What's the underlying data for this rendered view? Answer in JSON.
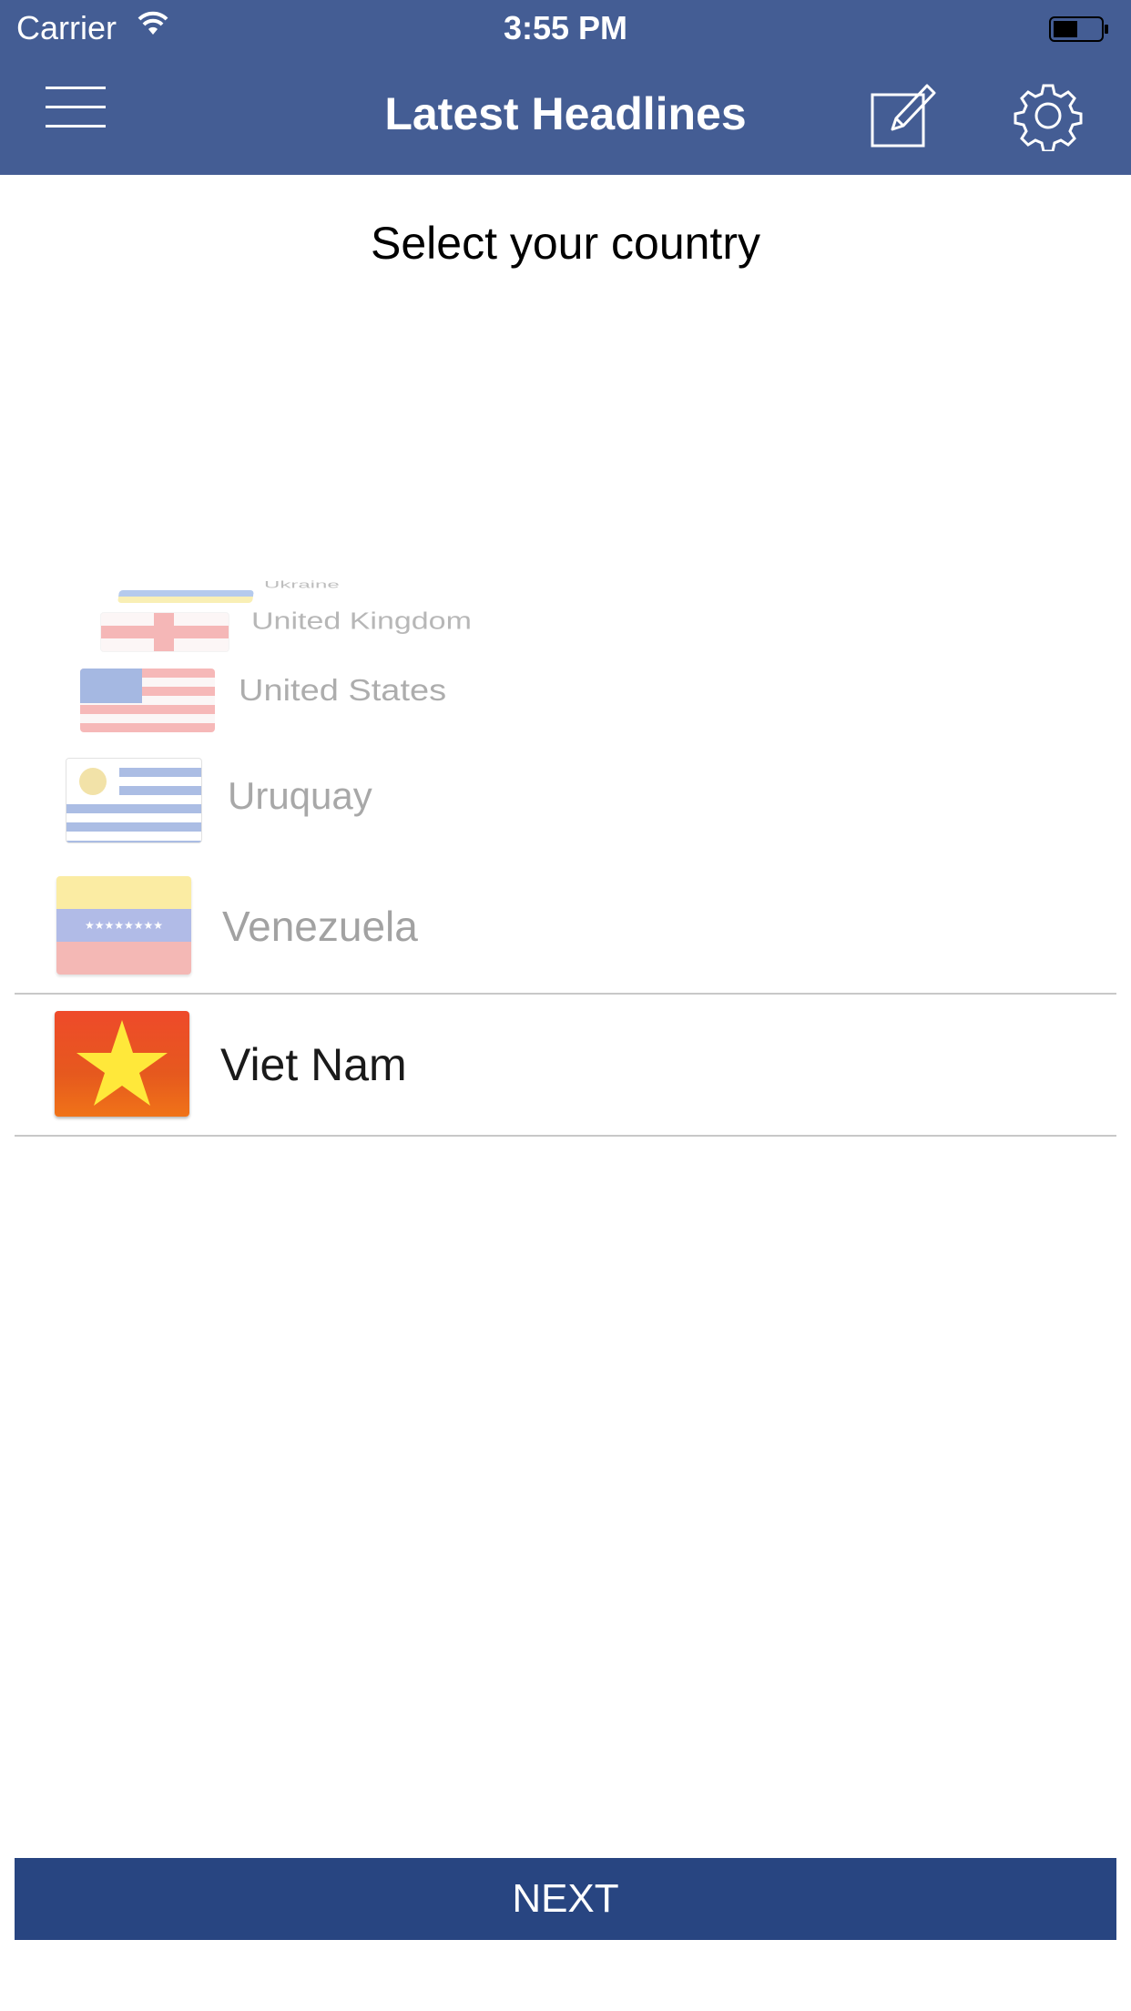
{
  "status_bar": {
    "carrier": "Carrier",
    "time": "3:55 PM"
  },
  "header": {
    "title": "Latest Headlines",
    "menu_icon": "hamburger-menu-icon",
    "compose_icon": "compose-icon",
    "settings_icon": "gear-icon"
  },
  "subtitle": "Select your country",
  "countries": [
    {
      "name": "Ukraine",
      "flag_icon": "ukraine-flag-icon"
    },
    {
      "name": "United Kingdom",
      "flag_icon": "england-flag-icon"
    },
    {
      "name": "United States",
      "flag_icon": "us-flag-icon"
    },
    {
      "name": "Uruquay",
      "flag_icon": "uruguay-flag-icon"
    },
    {
      "name": "Venezuela",
      "flag_icon": "venezuela-flag-icon"
    },
    {
      "name": "Viet Nam",
      "flag_icon": "vietnam-flag-icon",
      "selected": true
    }
  ],
  "next_button": "NEXT",
  "colors": {
    "header": "#445d94",
    "button": "#284581"
  }
}
